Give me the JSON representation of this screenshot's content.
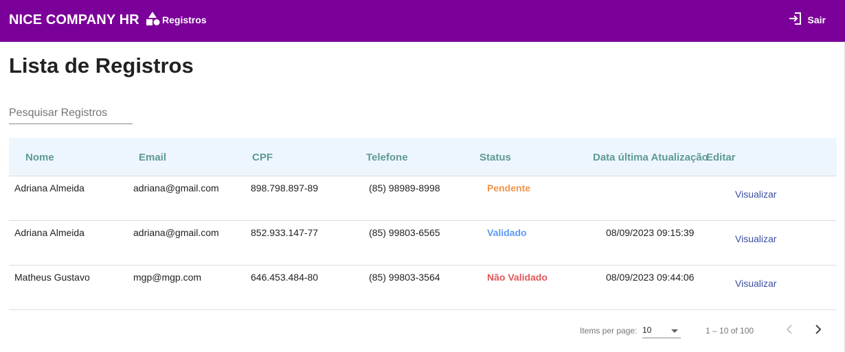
{
  "header": {
    "brand": "NICE COMPANY HR",
    "nav_registros": "Registros",
    "nav_registros_icon": "shapes-icon",
    "logout_label": "Sair",
    "logout_icon": "logout-icon",
    "bar_color": "#7b0099"
  },
  "page": {
    "title": "Lista de Registros"
  },
  "search": {
    "placeholder": "Pesquisar Registros",
    "value": ""
  },
  "table": {
    "columns": [
      "Nome",
      "Email",
      "CPF",
      "Telefone",
      "Status",
      "Data última Atualização",
      "Editar"
    ],
    "rows": [
      {
        "nome": "Adriana Almeida",
        "email": "adriana@gmail.com",
        "cpf": "898.798.897-89",
        "telefone": "(85) 98989-8998",
        "status": "Pendente",
        "status_color": "#f0954a",
        "data": "",
        "action": "Visualizar"
      },
      {
        "nome": "Adriana Almeida",
        "email": "adriana@gmail.com",
        "cpf": "852.933.147-77",
        "telefone": "(85) 99803-6565",
        "status": "Validado",
        "status_color": "#5b9af5",
        "data": "08/09/2023 09:15:39",
        "action": "Visualizar"
      },
      {
        "nome": "Matheus Gustavo",
        "email": "mgp@mgp.com",
        "cpf": "646.453.484-80",
        "telefone": "(85) 99803-3564",
        "status": "Não Validado",
        "status_color": "#e0585a",
        "data": "08/09/2023 09:44:06",
        "action": "Visualizar"
      }
    ]
  },
  "paginator": {
    "items_per_page_label": "Items per page:",
    "page_size": "10",
    "range_label": "1 – 10 of 100",
    "prev_icon": "chevron-left-icon",
    "next_icon": "chevron-right-icon"
  }
}
